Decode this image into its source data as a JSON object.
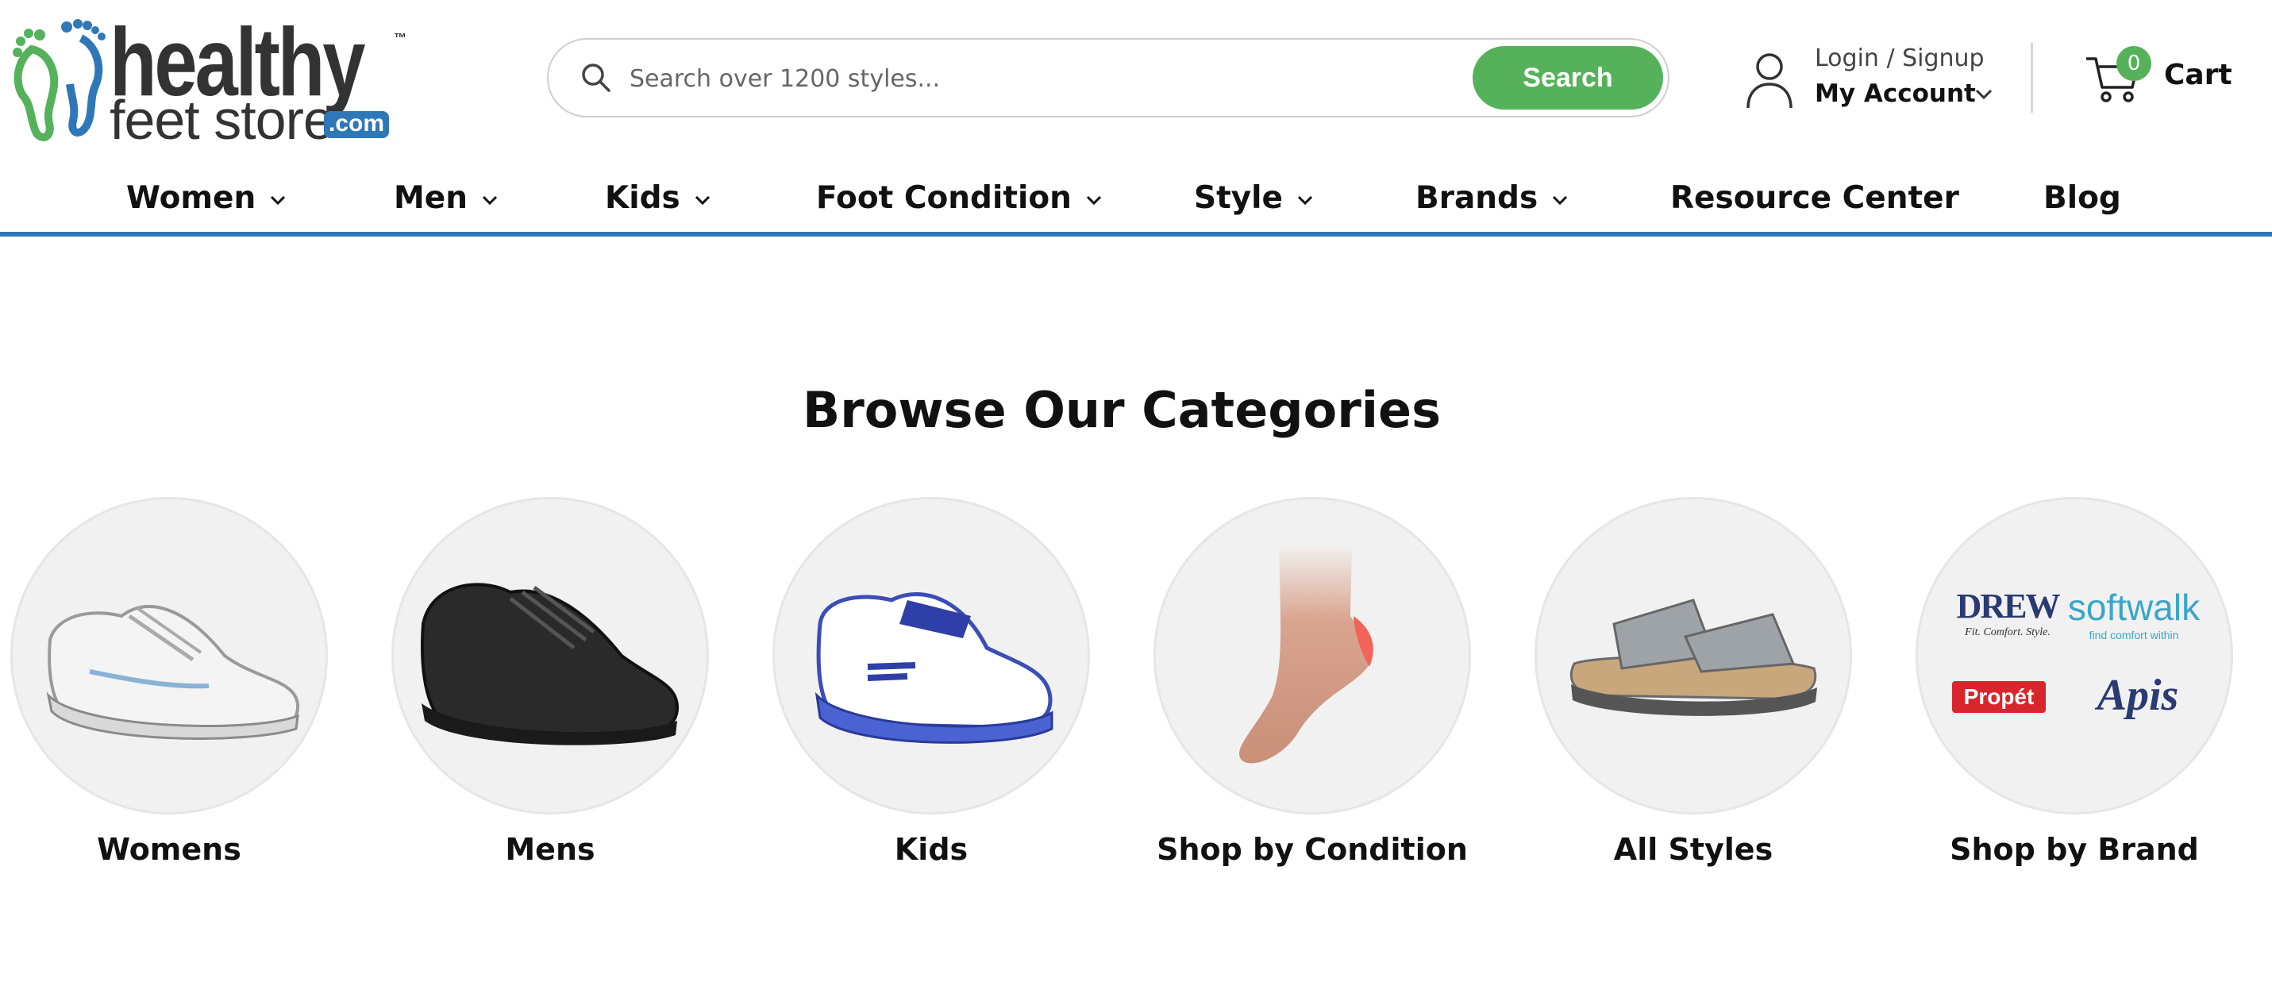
{
  "logo": {
    "line1": "healthy",
    "line2": "feet store",
    "com": ".com",
    "tm": "™"
  },
  "search": {
    "placeholder": "Search over 1200 styles...",
    "value": "",
    "button_label": "Search"
  },
  "account": {
    "login_label": "Login / Signup",
    "account_label": "My Account"
  },
  "cart": {
    "count": "0",
    "label": "Cart"
  },
  "nav": {
    "items": [
      {
        "label": "Women"
      },
      {
        "label": "Men"
      },
      {
        "label": "Kids"
      },
      {
        "label": "Foot Condition"
      },
      {
        "label": "Style"
      },
      {
        "label": "Brands"
      },
      {
        "label": "Resource Center"
      },
      {
        "label": "Blog"
      }
    ]
  },
  "categories": {
    "title": "Browse Our Categories",
    "items": [
      {
        "label": "Womens"
      },
      {
        "label": "Mens"
      },
      {
        "label": "Kids"
      },
      {
        "label": "Shop by Condition"
      },
      {
        "label": "All Styles"
      },
      {
        "label": "Shop by Brand"
      }
    ],
    "brand_logos": {
      "drew": "DREW",
      "drew_tag": "Fit. Comfort. Style.",
      "softwalk": "softwalk",
      "softwalk_tag": "find comfort within",
      "propet": "Propét",
      "apis": "Apis"
    }
  },
  "colors": {
    "accent_green": "#55b25a",
    "accent_blue": "#2f78b7",
    "text_dark": "#111111"
  }
}
